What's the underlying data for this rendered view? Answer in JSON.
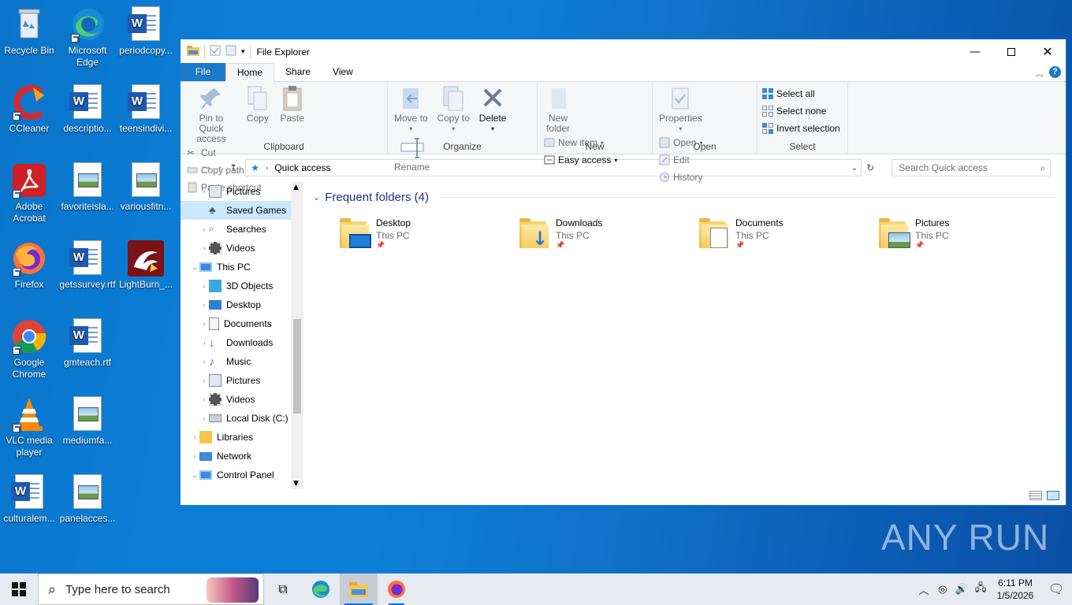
{
  "desktop": {
    "icons": [
      {
        "label": "Recycle Bin"
      },
      {
        "label": "Microsoft Edge"
      },
      {
        "label": "periodcopy..."
      },
      {
        "label": "CCleaner"
      },
      {
        "label": "descriptio..."
      },
      {
        "label": "teensindivi..."
      },
      {
        "label": "Adobe Acrobat"
      },
      {
        "label": "favoriteisla..."
      },
      {
        "label": "variousfitn..."
      },
      {
        "label": "Firefox"
      },
      {
        "label": "getssurvey.rtf"
      },
      {
        "label": "LightBurn_..."
      },
      {
        "label": "Google Chrome"
      },
      {
        "label": "gmteach.rtf"
      },
      {
        "label": "VLC media player"
      },
      {
        "label": "mediumfa..."
      },
      {
        "label": "culturalem..."
      },
      {
        "label": "panelacces..."
      }
    ]
  },
  "explorer": {
    "title": "File Explorer",
    "tabs": {
      "file": "File",
      "home": "Home",
      "share": "Share",
      "view": "View"
    },
    "ribbon": {
      "clipboard": {
        "label": "Clipboard",
        "pin": "Pin to Quick access",
        "copy": "Copy",
        "paste": "Paste",
        "cut": "Cut",
        "copy_path": "Copy path",
        "paste_shortcut": "Paste shortcut"
      },
      "organize": {
        "label": "Organize",
        "move_to": "Move to",
        "copy_to": "Copy to",
        "delete": "Delete",
        "rename": "Rename"
      },
      "new": {
        "label": "New",
        "new_folder": "New folder",
        "new_item": "New item",
        "easy_access": "Easy access"
      },
      "open": {
        "label": "Open",
        "properties": "Properties",
        "open": "Open",
        "edit": "Edit",
        "history": "History"
      },
      "select": {
        "label": "Select",
        "select_all": "Select all",
        "select_none": "Select none",
        "invert": "Invert selection"
      }
    },
    "address": {
      "path": "Quick access",
      "search_placeholder": "Search Quick access"
    },
    "nav": [
      {
        "label": "Pictures",
        "icon": "pictures-icon",
        "indent": 1
      },
      {
        "label": "Saved Games",
        "icon": "saved-games-icon",
        "indent": 1,
        "selected": true
      },
      {
        "label": "Searches",
        "icon": "searches-icon",
        "indent": 1
      },
      {
        "label": "Videos",
        "icon": "videos-icon",
        "indent": 1
      },
      {
        "label": "This PC",
        "icon": "this-pc-icon",
        "indent": 0,
        "expanded": true
      },
      {
        "label": "3D Objects",
        "icon": "3d-objects-icon",
        "indent": 1
      },
      {
        "label": "Desktop",
        "icon": "desktop-icon",
        "indent": 1
      },
      {
        "label": "Documents",
        "icon": "documents-icon",
        "indent": 1
      },
      {
        "label": "Downloads",
        "icon": "downloads-icon",
        "indent": 1
      },
      {
        "label": "Music",
        "icon": "music-icon",
        "indent": 1
      },
      {
        "label": "Pictures",
        "icon": "pictures-icon",
        "indent": 1
      },
      {
        "label": "Videos",
        "icon": "videos-icon",
        "indent": 1
      },
      {
        "label": "Local Disk (C:)",
        "icon": "local-disk-icon",
        "indent": 1
      },
      {
        "label": "Libraries",
        "icon": "libraries-icon",
        "indent": 0
      },
      {
        "label": "Network",
        "icon": "network-icon",
        "indent": 0
      },
      {
        "label": "Control Panel",
        "icon": "control-panel-icon",
        "indent": 0,
        "expanded": true
      }
    ],
    "section_title": "Frequent folders (4)",
    "folders": [
      {
        "name": "Desktop",
        "location": "This PC"
      },
      {
        "name": "Downloads",
        "location": "This PC"
      },
      {
        "name": "Documents",
        "location": "This PC"
      },
      {
        "name": "Pictures",
        "location": "This PC"
      }
    ]
  },
  "taskbar": {
    "search_placeholder": "Type here to search",
    "time": "6:11 PM",
    "date": "1/5/2026"
  },
  "watermark": "ANY RUN"
}
